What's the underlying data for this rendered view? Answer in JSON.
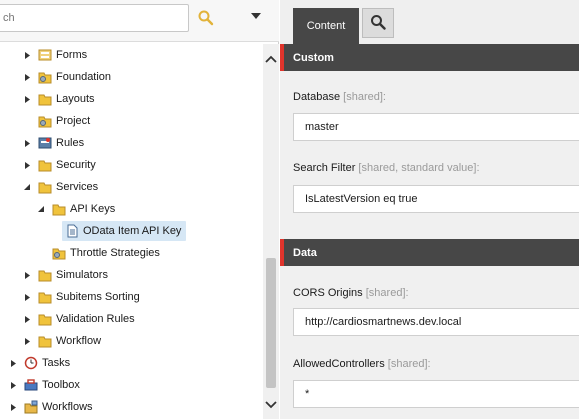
{
  "search": {
    "placeholder": "ch",
    "value": ""
  },
  "tree": [
    {
      "label": "Forms",
      "icon": "form-icon",
      "expanded": false,
      "level": 2
    },
    {
      "label": "Foundation",
      "icon": "folder-gear-icon",
      "expanded": false,
      "level": 2
    },
    {
      "label": "Layouts",
      "icon": "folder-icon",
      "expanded": false,
      "level": 2
    },
    {
      "label": "Project",
      "icon": "folder-gear-icon",
      "expanded": null,
      "level": 2
    },
    {
      "label": "Rules",
      "icon": "rules-icon",
      "expanded": false,
      "level": 2
    },
    {
      "label": "Security",
      "icon": "folder-icon",
      "expanded": false,
      "level": 2
    },
    {
      "label": "Services",
      "icon": "folder-icon",
      "expanded": true,
      "level": 2
    },
    {
      "label": "API Keys",
      "icon": "folder-icon",
      "expanded": true,
      "level": 3
    },
    {
      "label": "OData Item API Key",
      "icon": "document-icon",
      "expanded": null,
      "level": 4,
      "selected": true
    },
    {
      "label": "Throttle Strategies",
      "icon": "folder-gear-icon",
      "expanded": null,
      "level": 3
    },
    {
      "label": "Simulators",
      "icon": "folder-icon",
      "expanded": false,
      "level": 2
    },
    {
      "label": "Subitems Sorting",
      "icon": "folder-icon",
      "expanded": false,
      "level": 2
    },
    {
      "label": "Validation Rules",
      "icon": "folder-icon",
      "expanded": false,
      "level": 2
    },
    {
      "label": "Workflow",
      "icon": "folder-icon",
      "expanded": false,
      "level": 2
    },
    {
      "label": "Tasks",
      "icon": "clock-icon",
      "expanded": false,
      "level": 1
    },
    {
      "label": "Toolbox",
      "icon": "toolbox-icon",
      "expanded": false,
      "level": 1
    },
    {
      "label": "Workflows",
      "icon": "workflows-icon",
      "expanded": false,
      "level": 1
    }
  ],
  "editor": {
    "tabs": {
      "content": "Content"
    },
    "sections": [
      {
        "title": "Custom",
        "fields": [
          {
            "name": "Database",
            "meta": "[shared]:",
            "value": "master"
          },
          {
            "name": "Search Filter",
            "meta": "[shared, standard value]:",
            "value": "IsLatestVersion eq true"
          }
        ]
      },
      {
        "title": "Data",
        "fields": [
          {
            "name": "CORS Origins",
            "meta": "[shared]:",
            "value": "http://cardiosmartnews.dev.local"
          },
          {
            "name": "AllowedControllers",
            "meta": "[shared]:",
            "value": "*"
          }
        ]
      }
    ]
  },
  "colors": {
    "accent": "#e0342c",
    "header": "#474747",
    "selection": "#d6e7f5",
    "folder": "#f0c33c"
  }
}
